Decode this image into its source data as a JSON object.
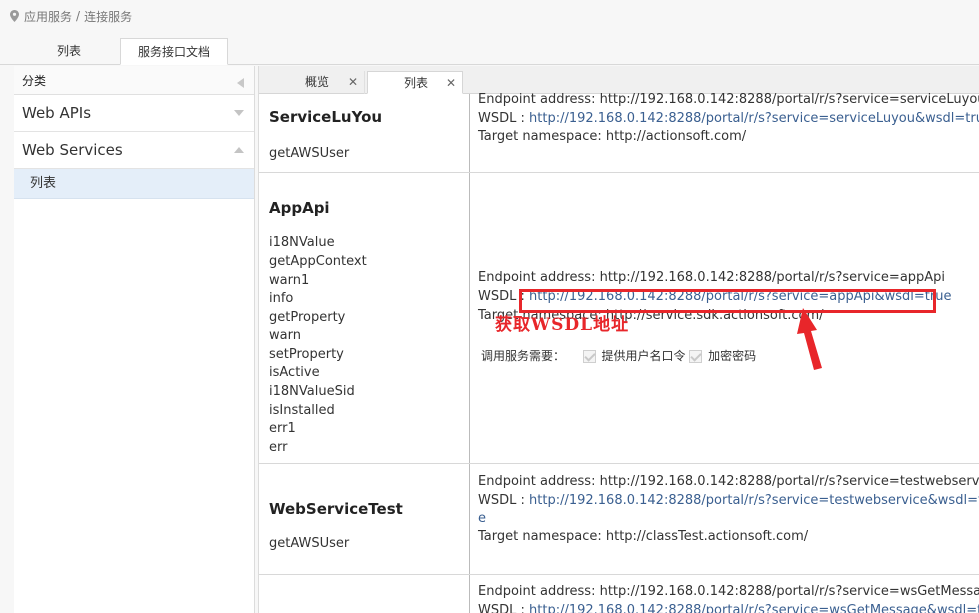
{
  "breadcrumb": {
    "part1": "应用服务",
    "separator": "/",
    "part2": "连接服务"
  },
  "top_tabs": [
    {
      "label": "列表"
    },
    {
      "label": "服务接口文档"
    }
  ],
  "sidebar": {
    "header": "分类",
    "groups": [
      {
        "label": "Web APIs"
      },
      {
        "label": "Web Services"
      }
    ],
    "items": [
      {
        "label": "列表"
      }
    ]
  },
  "inner_tabs": [
    {
      "label": "概览"
    },
    {
      "label": "列表"
    }
  ],
  "services": [
    {
      "name": "ServiceLuYou",
      "methods": [
        "getAWSUser"
      ],
      "endpoint": "Endpoint address: http://192.168.0.142:8288/portal/r/s?service=serviceLuyou",
      "wsdl_label": "WSDL :",
      "wsdl_url": "http://192.168.0.142:8288/portal/r/s?service=serviceLuyou&wsdl=true",
      "namespace": "Target namespace: http://actionsoft.com/"
    },
    {
      "name": "AppApi",
      "methods": [
        "i18NValue",
        "getAppContext",
        "warn1",
        "info",
        "getProperty",
        "warn",
        "setProperty",
        "isActive",
        "i18NValueSid",
        "isInstalled",
        "err1",
        "err"
      ],
      "endpoint": "Endpoint address: http://192.168.0.142:8288/portal/r/s?service=appApi",
      "wsdl_label": "WSDL :",
      "wsdl_url": "http://192.168.0.142:8288/portal/r/s?service=appApi&wsdl=true",
      "namespace": "Target namespace: http://service.sdk.actionsoft.com/",
      "requirements_label": "调用服务需要：",
      "option1": "提供用户名口令",
      "option2": "加密密码"
    },
    {
      "name": "WebServiceTest",
      "methods": [
        "getAWSUser"
      ],
      "endpoint": "Endpoint address: http://192.168.0.142:8288/portal/r/s?service=testwebservice",
      "wsdl_label": "WSDL :",
      "wsdl_url_line1": "http://192.168.0.142:8288/portal/r/s?service=testwebservice&wsdl=tru",
      "wsdl_url_line2": "e",
      "namespace": "Target namespace: http://classTest.actionsoft.com/"
    },
    {
      "endpoint": "Endpoint address: http://192.168.0.142:8288/portal/r/s?service=wsGetMessage",
      "wsdl_label": "WSDL :",
      "wsdl_url": "http://192.168.0.142:8288/portal/r/s?service=wsGetMessage&wsdl=true"
    }
  ],
  "annotation": {
    "text": "获取WSDL地址",
    "color": "#e8262a"
  },
  "icons": {
    "location": "location-pin-icon",
    "close": "close-icon",
    "collapse": "collapse-left-icon",
    "expand": "chevron-down-icon",
    "collapse_group": "chevron-up-icon"
  }
}
